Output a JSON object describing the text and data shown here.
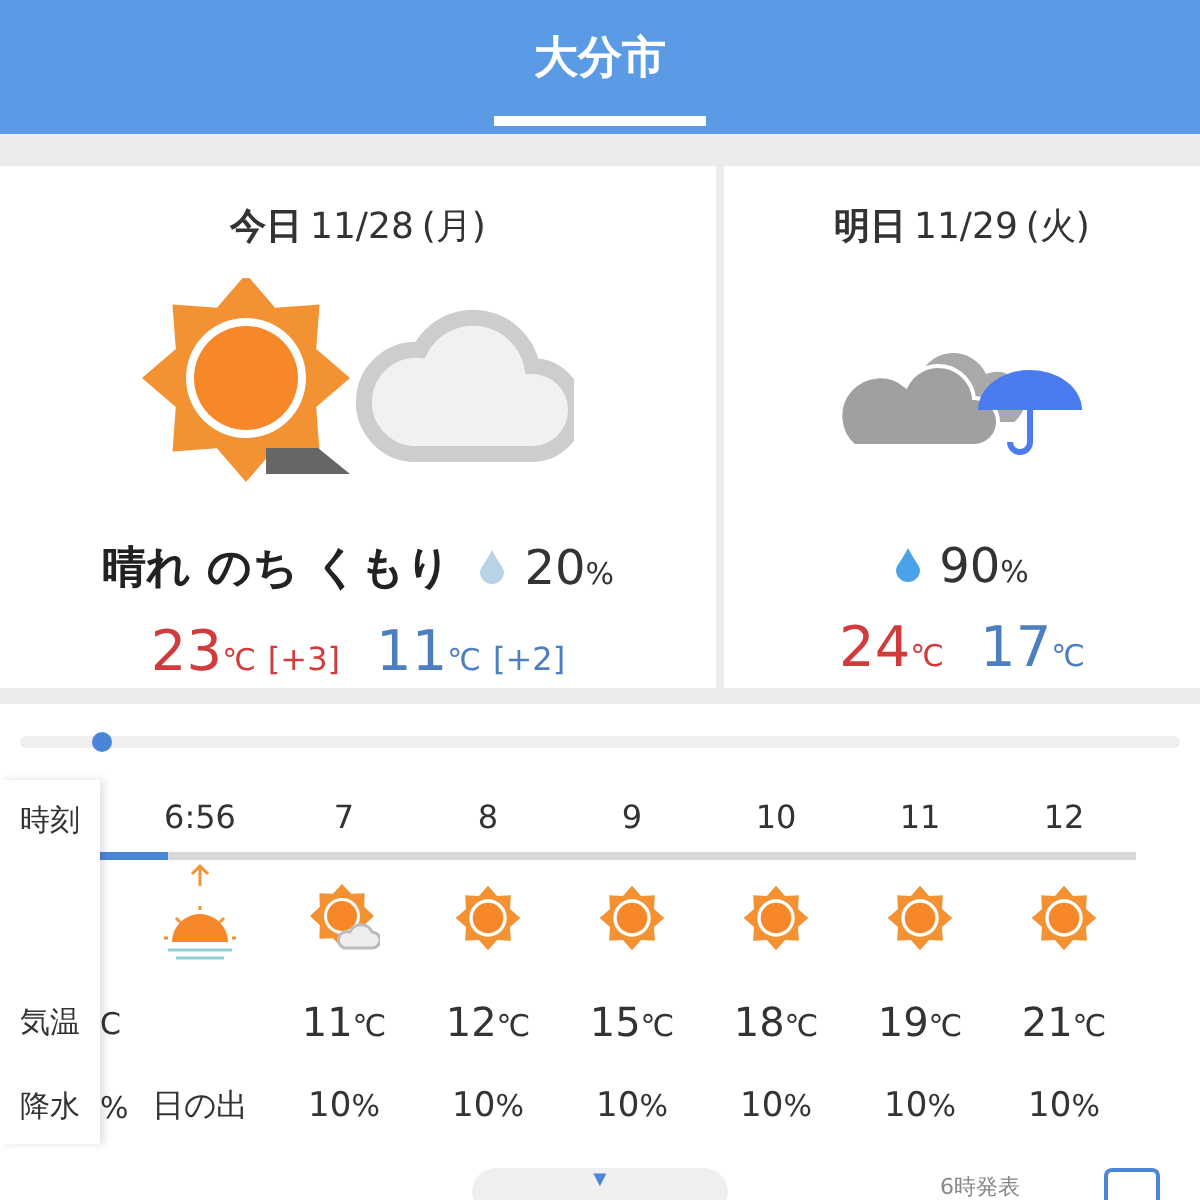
{
  "header": {
    "title": "大分市",
    "selected": true
  },
  "days": [
    {
      "label": "今日",
      "date": "11/28",
      "weekday": "(月)",
      "kind": "partly",
      "forecast": "晴れ のち くもり",
      "rain": "20",
      "rain_unit": "%",
      "high": {
        "value": "23",
        "unit": "℃",
        "diff": "[+3]"
      },
      "low": {
        "value": "11",
        "unit": "℃",
        "diff": "[+2]"
      }
    },
    {
      "label": "明日",
      "date": "11/29",
      "weekday": "(火)",
      "kind": "rainy",
      "rain": "90",
      "rain_unit": "%",
      "high": {
        "value": "24",
        "unit": "℃"
      },
      "low": {
        "value": "17",
        "unit": "℃"
      }
    }
  ],
  "timeline": {
    "level": 0.07
  },
  "hourly": {
    "labels": [
      "時刻",
      "気温",
      "降水"
    ],
    "columns": [
      {
        "kind": "partial",
        "temp_unit": "C",
        "rain_unit": "%"
      },
      {
        "kind": "sunrise",
        "time": "6:56",
        "rain": "日の出"
      },
      {
        "kind": "partly",
        "time": "7",
        "temp": "11",
        "temp_unit": "℃",
        "rain": "10",
        "rain_unit": "%"
      },
      {
        "kind": "sunny",
        "time": "8",
        "temp": "12",
        "temp_unit": "℃",
        "rain": "10",
        "rain_unit": "%"
      },
      {
        "kind": "sunny",
        "time": "9",
        "temp": "15",
        "temp_unit": "℃",
        "rain": "10",
        "rain_unit": "%"
      },
      {
        "kind": "sunny",
        "time": "10",
        "temp": "18",
        "temp_unit": "℃",
        "rain": "10",
        "rain_unit": "%"
      },
      {
        "kind": "sunny",
        "time": "11",
        "temp": "19",
        "temp_unit": "℃",
        "rain": "10",
        "rain_unit": "%"
      },
      {
        "kind": "sunny",
        "time": "12",
        "temp": "21",
        "temp_unit": "℃",
        "rain": "10",
        "rain_unit": "%"
      }
    ]
  },
  "footer": {
    "expand": "▼",
    "issued": "6時発表"
  }
}
